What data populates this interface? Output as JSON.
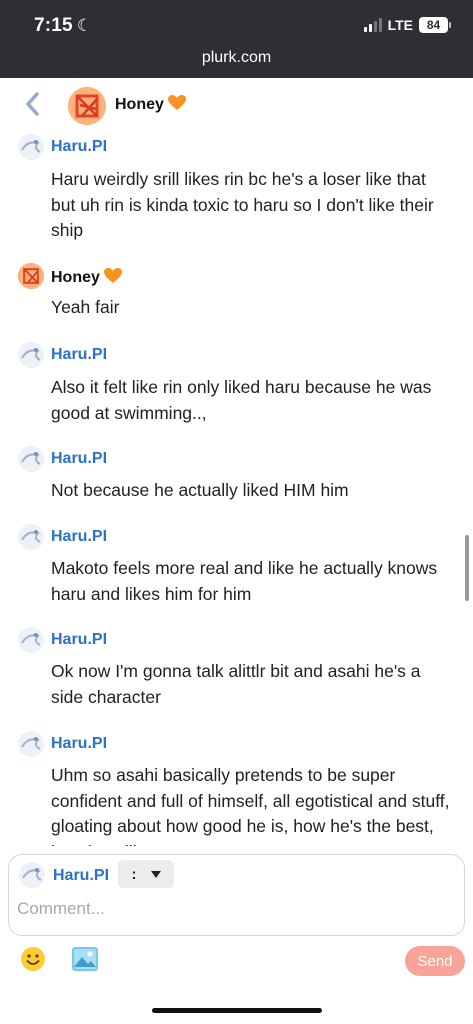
{
  "status_bar": {
    "time": "7:15",
    "network": "LTE",
    "battery": "84"
  },
  "browser": {
    "url": "plurk.com"
  },
  "header": {
    "title": "Honey",
    "heart": "orange-heart-icon"
  },
  "messages": [
    {
      "author": "Haru.PI",
      "text": "Haru weirdly srill likes rin bc he's a loser like that but uh rin is kinda toxic to haru so I don't like their ship"
    },
    {
      "author": "Honey",
      "text": "Yeah fair"
    },
    {
      "author": "Haru.PI",
      "text": "Also it felt like rin only liked haru because he was good at swimming..,"
    },
    {
      "author": "Haru.PI",
      "text": "Not because he actually liked HIM him"
    },
    {
      "author": "Haru.PI",
      "text": "Makoto feels more real and like he actually knows haru and likes him for him"
    },
    {
      "author": "Haru.PI",
      "text": "Ok now I'm gonna talk alittlr bit and asahi he's a side character"
    },
    {
      "author": "Haru.PI",
      "text": "Uhm so asahi basically pretends to be super confident and full of himself, all egotistical and stuff, gloating about how good he is, how he's the best, how he will s..."
    }
  ],
  "composer": {
    "author": "Haru.PI",
    "qualifier": ":",
    "placeholder": "Comment...",
    "send_label": "Send"
  },
  "colors": {
    "author_blue": "#2a73c7",
    "send_pink": "#f9a39a",
    "topbar": "#2e2f33"
  }
}
